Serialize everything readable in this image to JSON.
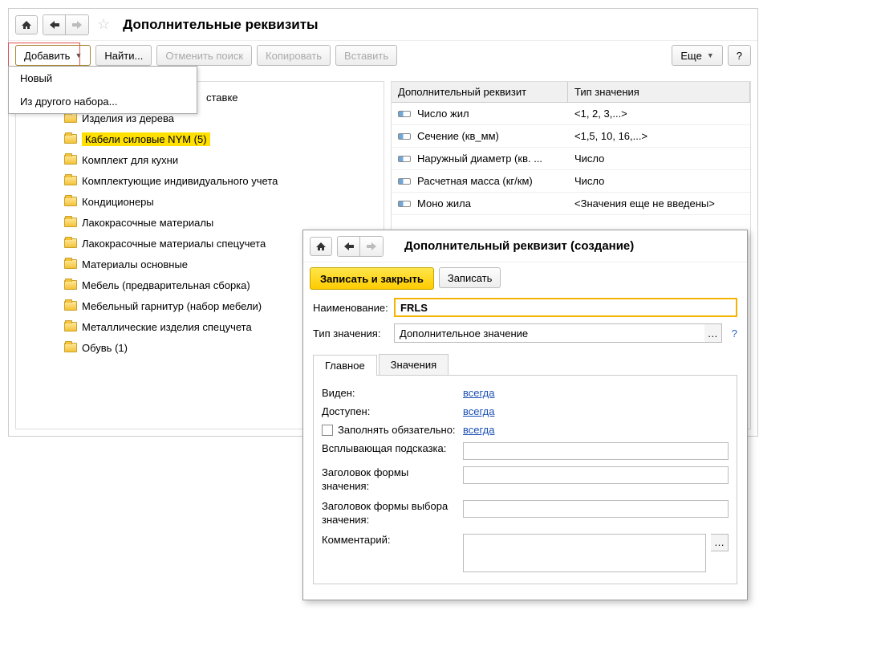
{
  "main": {
    "title": "Дополнительные реквизиты",
    "toolbar": {
      "add": "Добавить",
      "find": "Найти...",
      "cancel_search": "Отменить поиск",
      "copy": "Копировать",
      "paste": "Вставить",
      "more": "Еще",
      "help": "?"
    },
    "menu": {
      "new": "Новый",
      "from_set": "Из другого набора..."
    },
    "tree_cropped": "ставке",
    "tree": [
      "Изделия из дерева",
      "Кабели силовые NYM (5)",
      "Комплект для кухни",
      "Комплектующие индивидуального учета",
      "Кондиционеры",
      "Лакокрасочные материалы",
      "Лакокрасочные материалы спецучета",
      "Материалы основные",
      "Мебель (предварительная сборка)",
      "Мебельный гарнитур (набор мебели)",
      "Металлические изделия спецучета",
      "Обувь (1)"
    ],
    "grid": {
      "head_prop": "Дополнительный реквизит",
      "head_type": "Тип значения",
      "rows": [
        {
          "name": "Число жил",
          "type": "<1, 2, 3,...>"
        },
        {
          "name": "Сечение (кв_мм)",
          "type": "<1,5, 10, 16,...>"
        },
        {
          "name": "Наружный диаметр (кв. ...",
          "type": "Число"
        },
        {
          "name": "Расчетная масса (кг/км)",
          "type": "Число"
        },
        {
          "name": "Моно жила",
          "type": "<Значения еще не введены>"
        }
      ]
    }
  },
  "dialog": {
    "title": "Дополнительный реквизит (создание)",
    "save_close": "Записать и закрыть",
    "save": "Записать",
    "name_label": "Наименование:",
    "name_value": "FRLS",
    "type_label": "Тип значения:",
    "type_value": "Дополнительное значение",
    "help": "?",
    "tabs": {
      "main": "Главное",
      "values": "Значения"
    },
    "fields": {
      "visible": "Виден:",
      "available": "Доступен:",
      "required": "Заполнять обязательно:",
      "link_always": "всегда",
      "tooltip": "Всплывающая подсказка:",
      "form_title": "Заголовок формы значения:",
      "form_choice_title": "Заголовок формы выбора значения:",
      "comment": "Комментарий:"
    }
  }
}
